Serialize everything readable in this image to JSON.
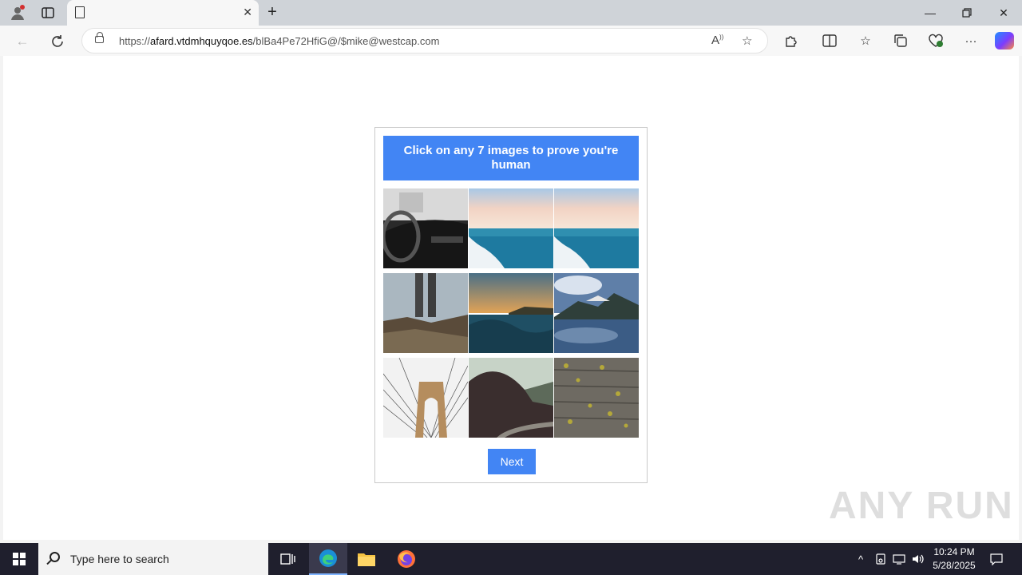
{
  "browser": {
    "tab_title": "",
    "url_prefix": "https://",
    "url_host": "afard.vtdmhquyqoe.es",
    "url_path": "/blBa4Pe72HfiG@/$mike@westcap.com"
  },
  "captcha": {
    "instruction": "Click on any 7 images to prove you're human",
    "next_label": "Next",
    "accent_color": "#4285f4",
    "tiles": [
      {
        "subject": "car interior"
      },
      {
        "subject": "sea horizon"
      },
      {
        "subject": "sea horizon"
      },
      {
        "subject": "legs on rocks"
      },
      {
        "subject": "ocean wave"
      },
      {
        "subject": "mountain lake"
      },
      {
        "subject": "bridge cables"
      },
      {
        "subject": "mountain road"
      },
      {
        "subject": "wooden planks"
      }
    ]
  },
  "watermark": "ANY RUN",
  "taskbar": {
    "search_placeholder": "Type here to search",
    "time": "10:24 PM",
    "date": "5/28/2025"
  }
}
